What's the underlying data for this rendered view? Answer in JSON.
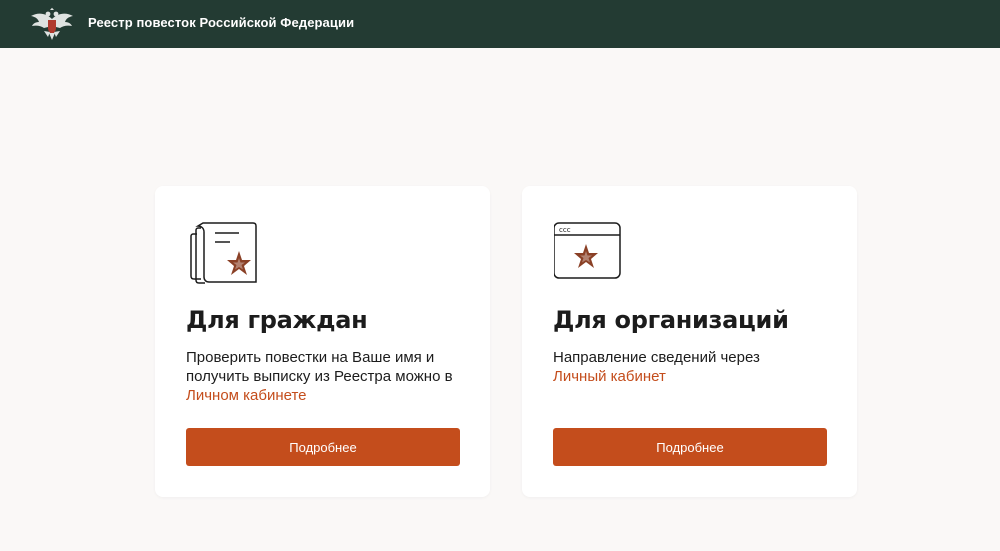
{
  "header": {
    "title": "Реестр повесток Российской Федерации",
    "logo_icon": "double-headed-eagle-emblem-icon"
  },
  "cards": [
    {
      "icon": "document-star-icon",
      "title": "Для граждан",
      "text": "Проверить повестки на Ваше имя и получить выписку из Реестра можно в",
      "link": "Личном кабинете",
      "button": "Подробнее"
    },
    {
      "icon": "browser-window-star-icon",
      "title": "Для организаций",
      "text": "Направление сведений через",
      "link": "Личный кабинет",
      "button": "Подробнее"
    }
  ],
  "colors": {
    "header_bg": "#233b33",
    "accent": "#c44d1c",
    "page_bg": "#faf8f7",
    "card_bg": "#ffffff",
    "text": "#1c1c1c"
  }
}
